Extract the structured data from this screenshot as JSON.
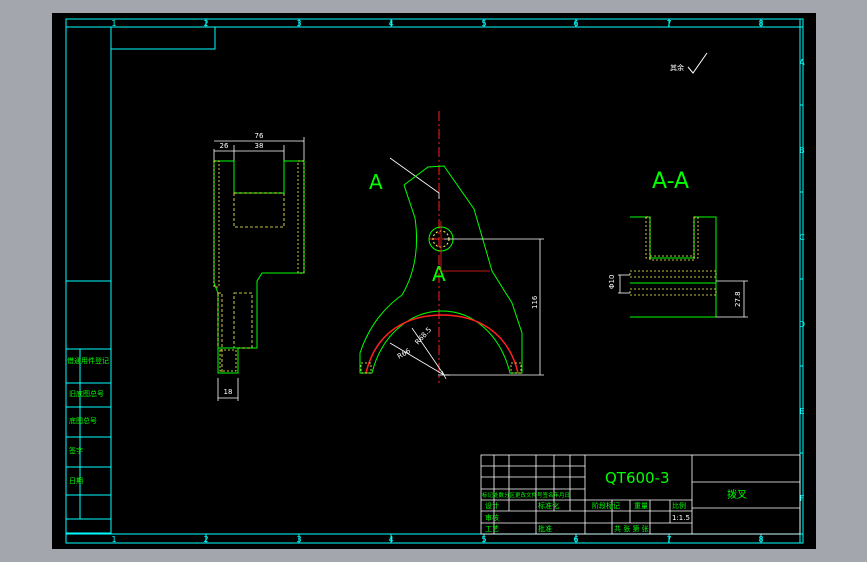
{
  "drawing": {
    "colors": {
      "background": "#a3a7ad",
      "canvas": "#000000",
      "frame": "#00ffff",
      "part": "#00ff00",
      "dimension": "#ffffff",
      "centerline": "#ff2020",
      "hatch": "#ffff55"
    },
    "zone_columns": [
      "1",
      "2",
      "3",
      "4",
      "5",
      "6",
      "7",
      "8"
    ],
    "zone_rows": [
      "A",
      "B",
      "C",
      "D",
      "E",
      "F"
    ],
    "surface_note": "其余",
    "left_view_dims": {
      "overall_width": "76",
      "left_offset": "26",
      "slot_width": "38",
      "bottom_width": "18"
    },
    "front_view": {
      "section_mark_left": "A",
      "section_mark_right": "A",
      "height_dim": "116",
      "outer_radius": "R68.5",
      "inner_radius": "R66"
    },
    "section_view": {
      "title": "A-A",
      "thickness_dim": "27.8",
      "hole_dim": "Φ10"
    },
    "title_block": {
      "material": "QT600-3",
      "drawing_name": "拨叉",
      "scale": "1:1.5",
      "labels": {
        "sign_marks": "标记处数分区更改文件号签名年月日",
        "designer": "设计",
        "standard": "标准化",
        "check": "审核",
        "process": "工艺",
        "approve": "批准",
        "stage_mark": "阶段标记",
        "weight": "重量",
        "scale_label": "比例",
        "sheets": "共  张  第  张"
      }
    },
    "side_labels": [
      "借通用件登记",
      "旧底图总号",
      "底图总号",
      "签字",
      "日期"
    ]
  }
}
